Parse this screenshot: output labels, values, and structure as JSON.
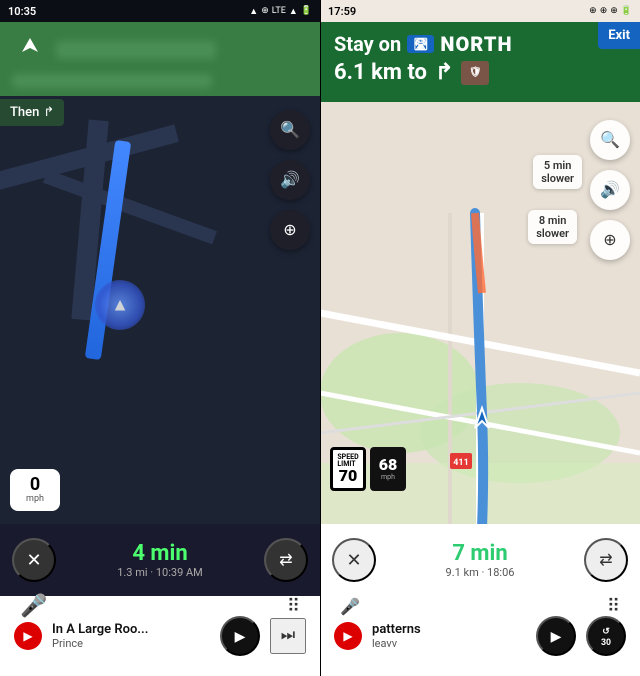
{
  "left": {
    "statusBar": {
      "time": "10:35",
      "icons": "▲ ⊕ LTE ▲ 🔋"
    },
    "navBanner": {
      "arrowDirection": "↑",
      "thenLabel": "Then",
      "thenArrow": "↱"
    },
    "mapButtons": [
      {
        "icon": "🔍",
        "name": "search"
      },
      {
        "icon": "🔊",
        "name": "sound"
      },
      {
        "icon": "⊕",
        "name": "layers"
      }
    ],
    "speed": {
      "value": "0",
      "unit": "mph"
    },
    "bottomBar": {
      "closeLabel": "✕",
      "eta": "4 min",
      "details": "1.3 mi · 10:39 AM",
      "routeLabel": "⇄"
    },
    "musicBar": {
      "iconLabel": "▶",
      "title": "In A Large Roo...",
      "artist": "Prince",
      "playIcon": "▶",
      "nextIcon": "⏭"
    },
    "homeBar": {
      "micIcon": "🎤",
      "gridIcon": "⠿"
    }
  },
  "right": {
    "statusBar": {
      "time": "17:59",
      "icons": "⊕ ⊕ ⊕ 🔋"
    },
    "navBanner": {
      "stayOnLabel": "Stay on",
      "highwayIcon": "🛣",
      "northLabel": "NORTH",
      "distanceLabel": "6.1 km to",
      "turnIcon": "↱",
      "shieldLabel": "🛡"
    },
    "exitBadge": "Exit",
    "mapButtons": [
      {
        "icon": "🔍",
        "name": "search"
      },
      {
        "icon": "🔊!",
        "name": "sound"
      },
      {
        "icon": "⊕",
        "name": "layers"
      }
    ],
    "trafficLabels": [
      {
        "text": "5 min\nslower",
        "top": "145",
        "right": "60"
      },
      {
        "text": "8 min\nslower",
        "top": "200",
        "right": "65"
      }
    ],
    "speedLimit": {
      "limitValue": "70",
      "currentValue": "68",
      "unit": "mph"
    },
    "bottomBar": {
      "closeLabel": "✕",
      "eta": "7 min",
      "details": "9.1 km · 18:06",
      "routeLabel": "⇄"
    },
    "musicBar": {
      "iconLabel": "▶",
      "title": "patterns",
      "artist": "leavv",
      "playIcon": "▶",
      "replayLabel": "30"
    },
    "homeBar": {
      "micIcon": "🎤",
      "gridIcon": "⠿"
    }
  }
}
